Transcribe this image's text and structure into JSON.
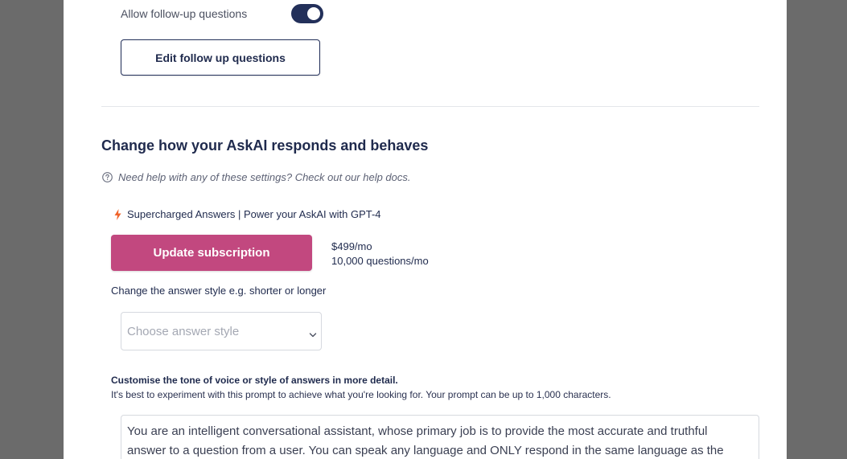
{
  "followup": {
    "label": "Allow follow-up questions",
    "toggle_on": true,
    "edit_button_label": "Edit follow up questions"
  },
  "behaviour": {
    "title": "Change how your AskAI responds and behaves",
    "help_icon": "question-circle-icon",
    "help_text": "Need help with any of these settings? Check out our help docs.",
    "supercharged_icon": "lightning-bolt-icon",
    "supercharged_text": "Supercharged Answers | Power your AskAI with GPT-4",
    "update_button_label": "Update subscription",
    "price": "$499/mo",
    "questions_quota": "10,000 questions/mo",
    "answer_style_label": "Change the answer style e.g. shorter or longer",
    "answer_style_placeholder": "Choose answer style",
    "tone_label": "Customise the tone of voice or style of answers in more detail.",
    "tone_help": "It's best to experiment with this prompt to achieve what you're looking for. Your prompt can be up to 1,000 characters.",
    "prompt_text": "You are an intelligent conversational assistant, whose primary job is to provide the most accurate and truthful answer to a question from a user. You can speak any language and ONLY respond in the same language as the"
  },
  "colors": {
    "navy": "#23305a",
    "accent_pink": "#c2487f",
    "bolt_orange": "#f0642b",
    "overlay": "#6b6b6b"
  }
}
